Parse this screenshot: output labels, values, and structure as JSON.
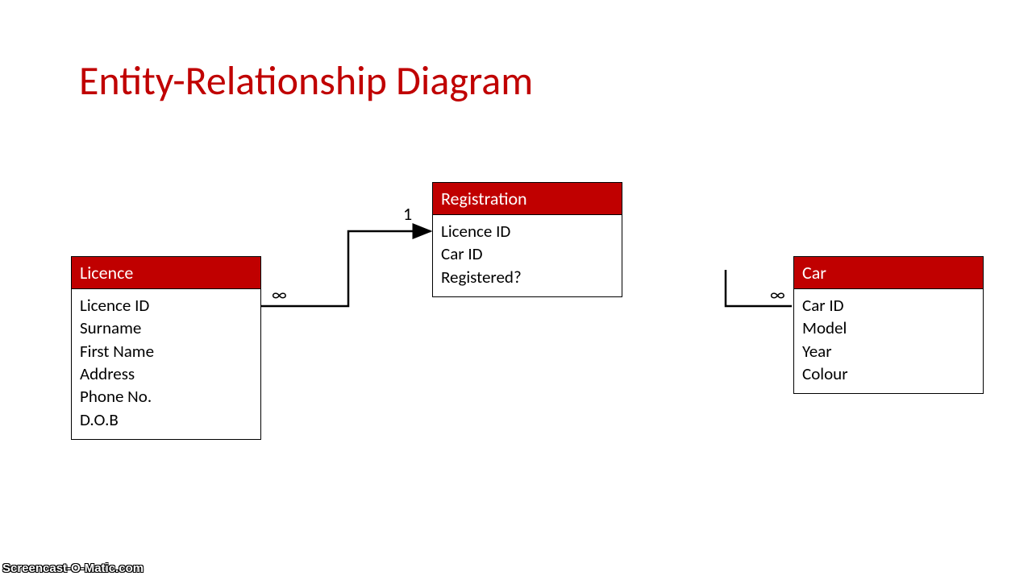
{
  "title": "Entity-Relationship Diagram",
  "entities": {
    "licence": {
      "name": "Licence",
      "attrs": [
        "Licence ID",
        "Surname",
        "First Name",
        "Address",
        "Phone No.",
        "D.O.B"
      ]
    },
    "registration": {
      "name": "Registration",
      "attrs": [
        "Licence ID",
        "Car ID",
        "Registered?"
      ]
    },
    "car": {
      "name": "Car",
      "attrs": [
        "Car ID",
        "Model",
        "Year",
        "Colour"
      ]
    }
  },
  "cardinality": {
    "licence_side": "∞",
    "registration_side": "1",
    "car_side": "∞"
  },
  "watermark": "Screencast-O-Matic.com"
}
